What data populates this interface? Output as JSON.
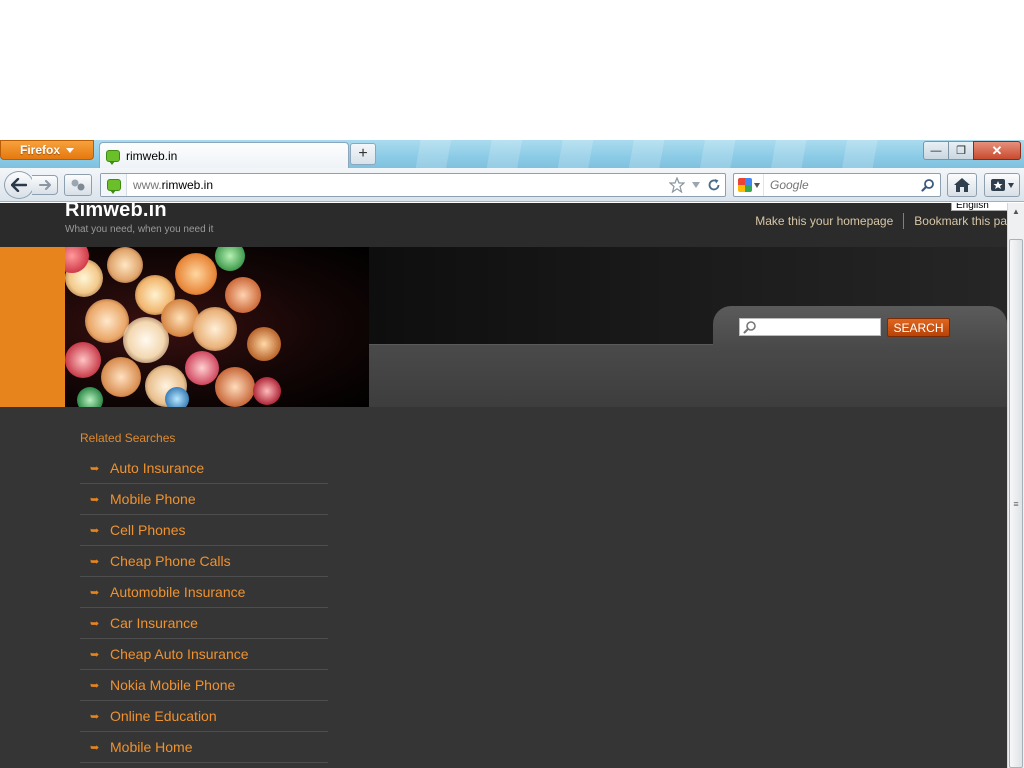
{
  "browser": {
    "menu_button": "Firefox",
    "tab_title": "rimweb.in",
    "new_tab": "+",
    "url_prefix": "www.",
    "url_domain": "rimweb.in",
    "search_placeholder": "Google",
    "window_controls": {
      "minimize": "—",
      "maximize": "❐",
      "close": "✕"
    }
  },
  "site": {
    "title": "Rimweb.in",
    "tagline": "What you need, when you need it",
    "language": "English",
    "header_links": [
      "Make this your homepage",
      "Bookmark this pa"
    ],
    "search_button": "SEARCH",
    "accent_color": "#e8841c"
  },
  "related": {
    "heading": "Related Searches",
    "items": [
      "Auto Insurance",
      "Mobile Phone",
      "Cell Phones",
      "Cheap Phone Calls",
      "Automobile Insurance",
      "Car Insurance",
      "Cheap Auto Insurance",
      "Nokia Mobile Phone",
      "Online Education",
      "Mobile Home"
    ]
  }
}
